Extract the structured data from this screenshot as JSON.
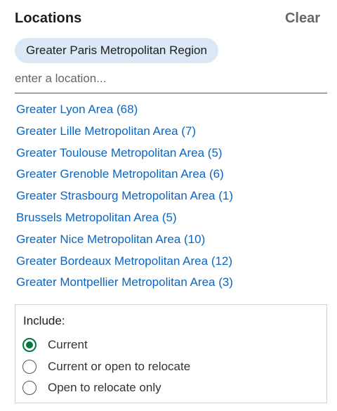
{
  "header": {
    "title": "Locations",
    "clear_label": "Clear"
  },
  "selected_chip": {
    "label": "Greater Paris Metropolitan Region"
  },
  "search": {
    "placeholder": "enter a location..."
  },
  "suggestions": [
    "Greater Lyon Area (68)",
    "Greater Lille Metropolitan Area (7)",
    "Greater Toulouse Metropolitan Area (5)",
    "Greater Grenoble Metropolitan Area (6)",
    "Greater Strasbourg Metropolitan Area (1)",
    "Brussels Metropolitan Area (5)",
    "Greater Nice Metropolitan Area (10)",
    "Greater Bordeaux Metropolitan Area (12)",
    "Greater Montpellier Metropolitan Area (3)"
  ],
  "include": {
    "label": "Include:",
    "options": [
      {
        "label": "Current",
        "checked": true
      },
      {
        "label": "Current or open to relocate",
        "checked": false
      },
      {
        "label": "Open to relocate only",
        "checked": false
      }
    ]
  },
  "colors": {
    "link": "#0a66c2",
    "chip_bg": "#dbe9f7",
    "radio_selected": "#057642"
  }
}
